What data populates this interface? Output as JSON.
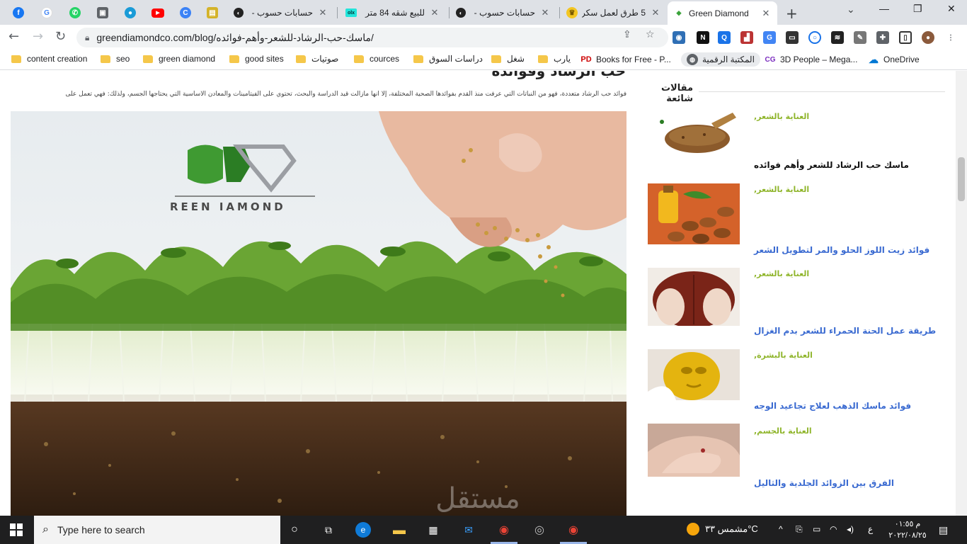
{
  "tabs": {
    "mini": [
      {
        "icon": "facebook-icon",
        "color": "#1877f2",
        "glyph": "f"
      },
      {
        "icon": "google-icon",
        "color": "#4285f4",
        "glyph": "G"
      },
      {
        "icon": "whatsapp-icon",
        "color": "#25d366",
        "glyph": "✆"
      },
      {
        "icon": "gallery-icon",
        "color": "#5f6368",
        "glyph": "▣"
      },
      {
        "icon": "circle-app-icon",
        "color": "#1a9bd7",
        "glyph": "●"
      },
      {
        "icon": "youtube-icon",
        "color": "#ff0000",
        "glyph": "▶"
      },
      {
        "icon": "cc-app-icon",
        "color": "#3b82f6",
        "glyph": "C"
      },
      {
        "icon": "notes-icon",
        "color": "#d4b32a",
        "glyph": "▤"
      }
    ],
    "full": [
      {
        "title": "حسابات حسوب -",
        "icon": "hsoub-icon"
      },
      {
        "title": "للبيع شقه 84 متر",
        "icon": "olx-icon"
      },
      {
        "title": "حسابات حسوب -",
        "icon": "hsoub-icon"
      },
      {
        "title": "5 طرق لعمل سكر",
        "icon": "crown-icon"
      },
      {
        "title": "Green Diamond",
        "icon": "green-diamond-icon",
        "active": true
      }
    ]
  },
  "toolbar": {
    "url": "greendiamondco.com/blog/ماسك-حب-الرشاد-للشعر-وأهم-فوائده/"
  },
  "bookmarks": [
    {
      "label": "content creation",
      "type": "folder"
    },
    {
      "label": "seo",
      "type": "folder"
    },
    {
      "label": "green diamond",
      "type": "folder"
    },
    {
      "label": "good sites",
      "type": "folder"
    },
    {
      "label": "صوتيات",
      "type": "folder"
    },
    {
      "label": "cources",
      "type": "folder"
    },
    {
      "label": "دراسات السوق",
      "type": "folder"
    },
    {
      "label": "شغل",
      "type": "folder"
    },
    {
      "label": "يارب",
      "type": "folder"
    },
    {
      "label": "Books for Free - P...",
      "type": "link"
    },
    {
      "label": "المكتبة الرقمية",
      "type": "link"
    },
    {
      "label": "3D People – Mega...",
      "type": "link"
    },
    {
      "label": "OneDrive",
      "type": "link"
    }
  ],
  "article": {
    "heading": "حب الرشاد وفوائده",
    "text": "فوائد حب الرشاد متعددة، فهو من النباتات التي عرفت منذ القدم بفوائدها الصحية المختلفة، إلا أنها مازالت قيد الدراسة والبحث، تحتوي على الفيتامينات والمعادن الأساسية التي يحتاجها الجسم، ولذلك: فهي تعمل على",
    "image_logo_text": "REEN  IAMOND"
  },
  "sidebar": {
    "title": "مقالات شائعة",
    "posts": [
      {
        "category": "العناية بالشعر,",
        "title": "ماسك حب الرشاد للشعر وأهم فوائده",
        "thumb": "seeds",
        "title_color": "#111111"
      },
      {
        "category": "العناية بالشعر,",
        "title": "فوائد زيت اللوز الحلو والمر لتطويل الشعر",
        "thumb": "almonds",
        "title_color": "#3b6bd1"
      },
      {
        "category": "العناية بالشعر,",
        "title": "طريقة عمل الحنة الحمراء للشعر بدم الغزال",
        "thumb": "henna",
        "title_color": "#3b6bd1"
      },
      {
        "category": "العناية بالبشرة,",
        "title": "فوائد ماسك الذهب لعلاج تجاعيد الوجه",
        "thumb": "gold",
        "title_color": "#3b6bd1"
      },
      {
        "category": "العناية بالجسم,",
        "title": "الفرق بين الزوائد الجلدية والثاليل",
        "thumb": "skin",
        "title_color": "#3b6bd1"
      }
    ]
  },
  "taskbar": {
    "search_text": "Type here to search",
    "weather_text": "مشمس ٣٣°C",
    "clock_time": "م ٠١:٥٥",
    "clock_date": "٢٠٢٢/٠٨/٢٥",
    "lang": "ع"
  }
}
